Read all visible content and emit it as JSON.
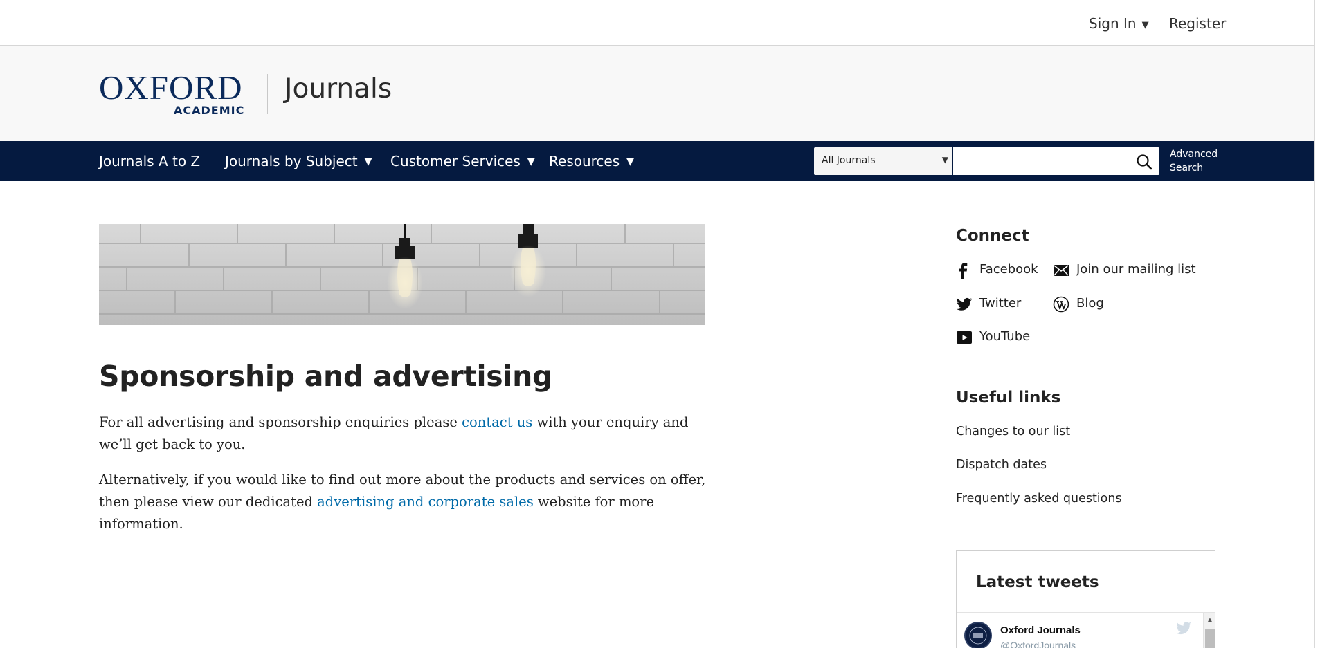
{
  "topbar": {
    "sign_in": "Sign In",
    "register": "Register"
  },
  "brand": {
    "logo_oxford": "OXFORD",
    "logo_academic": "ACADEMIC",
    "section": "Journals",
    "navy": "#051a40",
    "logo_blue": "#0b2a5b"
  },
  "nav": {
    "items": [
      {
        "label": "Journals A to Z",
        "has_menu": false
      },
      {
        "label": "Journals by Subject",
        "has_menu": true
      },
      {
        "label": "Customer Services",
        "has_menu": true
      },
      {
        "label": "Resources",
        "has_menu": true
      }
    ],
    "search": {
      "scope": "All Journals",
      "query": "",
      "advanced_line1": "Advanced",
      "advanced_line2": "Search"
    }
  },
  "main": {
    "title": "Sponsorship and advertising",
    "p1_before": " For all advertising and sponsorship enquiries please ",
    "p1_link": "contact us",
    "p1_after": " with your enquiry and we’ll get back to you.",
    "p2_before": "Alternatively, if you would like to find out more about the products and services on offer, then please view our dedicated ",
    "p2_link": "advertising and corporate sales",
    "p2_after": " website for more information.",
    "link_color": "#006aa8"
  },
  "sidebar": {
    "connect_heading": "Connect",
    "social": [
      {
        "label": "Facebook",
        "icon": "facebook-icon"
      },
      {
        "label": "Join our mailing list",
        "icon": "envelope-icon"
      },
      {
        "label": "Twitter",
        "icon": "twitter-icon"
      },
      {
        "label": "Blog",
        "icon": "wordpress-icon"
      },
      {
        "label": "YouTube",
        "icon": "youtube-icon"
      }
    ],
    "useful_heading": "Useful links",
    "useful_links": [
      "Changes to our list",
      "Dispatch dates",
      "Frequently asked questions"
    ],
    "tweets": {
      "heading": "Latest tweets",
      "account_name": "Oxford Journals",
      "account_handle": "@OxfordJournals"
    }
  }
}
